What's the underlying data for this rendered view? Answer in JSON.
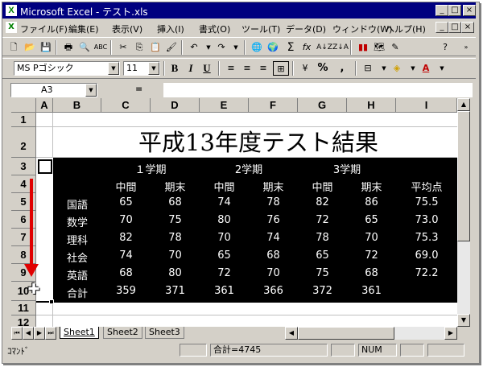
{
  "window": {
    "title": "Microsoft Excel - テスト.xls"
  },
  "menu": [
    "ファイル(F)",
    "編集(E)",
    "表示(V)",
    "挿入(I)",
    "書式(O)",
    "ツール(T)",
    "データ(D)",
    "ウィンドウ(W)",
    "ヘルプ(H)"
  ],
  "format_toolbar": {
    "font_name": "MS Pゴシック",
    "font_size": "11",
    "bold": "B",
    "italic": "I",
    "underline": "U",
    "percent": "%",
    "comma": ","
  },
  "standard_toolbar": {
    "sum": "Σ",
    "function": "fx"
  },
  "formula_bar": {
    "name_box": "A3",
    "equals": "=",
    "content": ""
  },
  "columns": [
    "A",
    "B",
    "C",
    "D",
    "E",
    "F",
    "G",
    "H",
    "I"
  ],
  "rows": [
    "1",
    "2",
    "3",
    "4",
    "5",
    "6",
    "7",
    "8",
    "9",
    "10",
    "11",
    "12"
  ],
  "sheet": {
    "title": "平成13年度テスト結果",
    "terms": [
      "１学期",
      "2学期",
      "3学期"
    ],
    "subheaders": [
      "中間",
      "期末",
      "中間",
      "期末",
      "中間",
      "期末",
      "平均点"
    ],
    "data_rows": [
      {
        "subject": "国語",
        "values": [
          "65",
          "68",
          "74",
          "78",
          "82",
          "86",
          "75.5"
        ]
      },
      {
        "subject": "数学",
        "values": [
          "70",
          "75",
          "80",
          "76",
          "72",
          "65",
          "73.0"
        ]
      },
      {
        "subject": "理科",
        "values": [
          "82",
          "78",
          "70",
          "74",
          "78",
          "70",
          "75.3"
        ]
      },
      {
        "subject": "社会",
        "values": [
          "74",
          "70",
          "65",
          "68",
          "65",
          "72",
          "69.0"
        ]
      },
      {
        "subject": "英語",
        "values": [
          "68",
          "80",
          "72",
          "70",
          "75",
          "68",
          "72.2"
        ]
      }
    ],
    "total_row": {
      "subject": "合計",
      "values": [
        "359",
        "371",
        "361",
        "366",
        "372",
        "361"
      ]
    }
  },
  "tabs": [
    "Sheet1",
    "Sheet2",
    "Sheet3"
  ],
  "status": {
    "mode": "ｺﾏﾝﾄﾞ",
    "sum": "合計=4745",
    "num": "NUM"
  },
  "colors": {
    "title_bar": "#000080",
    "selection": "#000000",
    "arrow": "#e00000"
  }
}
